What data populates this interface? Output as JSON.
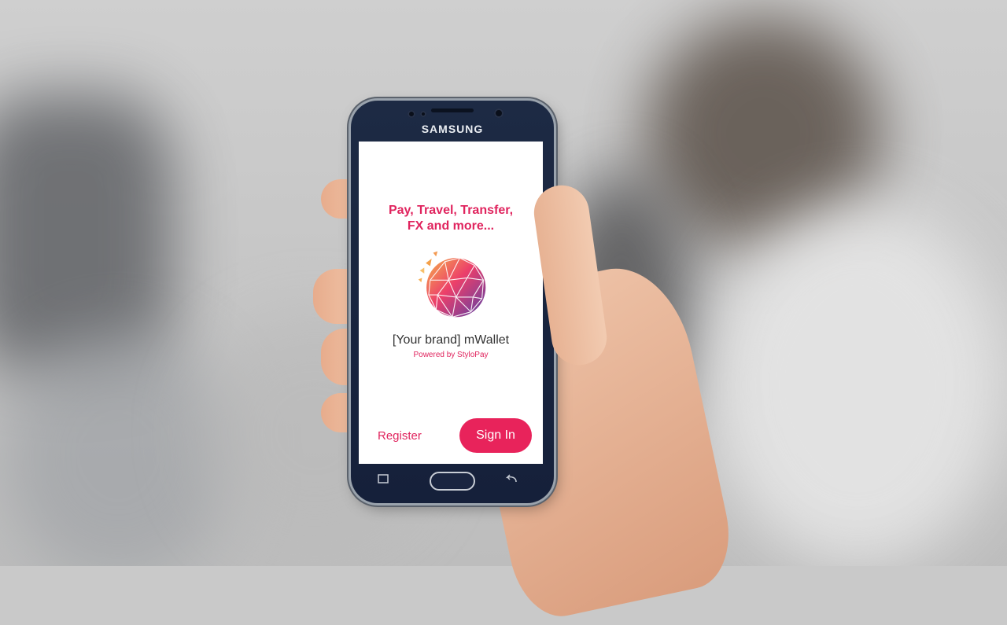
{
  "device": {
    "brand": "SAMSUNG"
  },
  "screen": {
    "headline_line1": "Pay, Travel, Transfer,",
    "headline_line2": "FX and more...",
    "app_name": "[Your brand] mWallet",
    "powered_by": "Powered by StyloPay",
    "register_label": "Register",
    "signin_label": "Sign In"
  },
  "colors": {
    "accent": "#e0245e",
    "button": "#e8235b",
    "phone_body": "#1d2a44"
  },
  "icons": {
    "logo": "geodesic-sphere-logo-icon",
    "nav_recent": "recent-apps-icon",
    "nav_back": "back-icon"
  }
}
